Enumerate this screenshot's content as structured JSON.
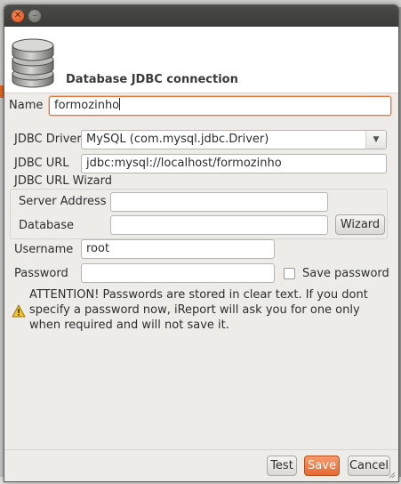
{
  "dialog": {
    "header_title": "Database JDBC connection",
    "window_buttons": {
      "close_icon": "close-icon",
      "minimize_icon": "minimize-icon"
    }
  },
  "form": {
    "name_label": "Name",
    "name_value": "formozinho",
    "jdbc_driver_label": "JDBC Driver",
    "jdbc_driver_value": "MySQL (com.mysql.jdbc.Driver)",
    "jdbc_url_label": "JDBC URL",
    "jdbc_url_value": "jdbc:mysql://localhost/formozinho",
    "wizard_group_label": "JDBC URL Wizard",
    "server_address_label": "Server Address",
    "server_address_value": "",
    "database_label": "Database",
    "database_value": "",
    "wizard_button": "Wizard",
    "username_label": "Username",
    "username_value": "root",
    "password_label": "Password",
    "password_value": "",
    "save_password_label": "Save password",
    "save_password_checked": false
  },
  "warning": {
    "icon": "warning-icon",
    "text": "ATTENTION! Passwords are stored in clear text. If you dont specify a password now, iReport will ask you for one only when required and will not save it."
  },
  "buttons": {
    "test": "Test",
    "save": "Save",
    "cancel": "Cancel"
  },
  "colors": {
    "accent": "#e66a32",
    "focus_border": "#e8733b",
    "warning": "#f2c12e"
  }
}
